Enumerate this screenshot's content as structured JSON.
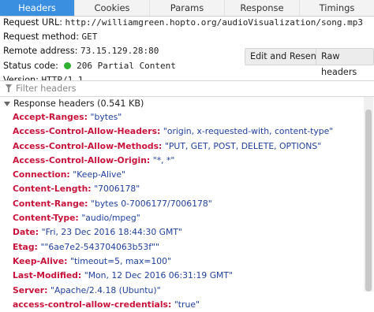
{
  "tabs": [
    {
      "label": "Headers",
      "active": true
    },
    {
      "label": "Cookies",
      "active": false
    },
    {
      "label": "Params",
      "active": false
    },
    {
      "label": "Response",
      "active": false
    },
    {
      "label": "Timings",
      "active": false
    }
  ],
  "summary": {
    "request_url_label": "Request URL:",
    "request_url": "http://williamgreen.hopto.org/audioVisualization/song.mp3",
    "request_method_label": "Request method:",
    "request_method": "GET",
    "remote_address_label": "Remote address:",
    "remote_address": "73.15.129.28:80",
    "status_code_label": "Status code:",
    "status_code": "206 Partial Content",
    "version_label": "Version:",
    "version": "HTTP/1.1"
  },
  "buttons": {
    "edit_resend": "Edit and Resend",
    "raw_headers": "Raw headers"
  },
  "filter": {
    "placeholder": "Filter headers"
  },
  "response_section": {
    "label": "Response headers (0.541 KB)"
  },
  "headers": [
    {
      "name": "Accept-Ranges:",
      "value": "\"bytes\""
    },
    {
      "name": "Access-Control-Allow-Headers:",
      "value": "\"origin, x-requested-with, content-type\""
    },
    {
      "name": "Access-Control-Allow-Methods:",
      "value": "\"PUT, GET, POST, DELETE, OPTIONS\""
    },
    {
      "name": "Access-Control-Allow-Origin:",
      "value": "\"*, *\""
    },
    {
      "name": "Connection:",
      "value": "\"Keep-Alive\""
    },
    {
      "name": "Content-Length:",
      "value": "\"7006178\""
    },
    {
      "name": "Content-Range:",
      "value": "\"bytes 0-7006177/7006178\""
    },
    {
      "name": "Content-Type:",
      "value": "\"audio/mpeg\""
    },
    {
      "name": "Date:",
      "value": "\"Fri, 23 Dec 2016 18:44:30 GMT\""
    },
    {
      "name": "Etag:",
      "value": "\"\"6ae7e2-543704063b53f\"\""
    },
    {
      "name": "Keep-Alive:",
      "value": "\"timeout=5, max=100\""
    },
    {
      "name": "Last-Modified:",
      "value": "\"Mon, 12 Dec 2016 06:31:19 GMT\""
    },
    {
      "name": "Server:",
      "value": "\"Apache/2.4.18 (Ubuntu)\""
    },
    {
      "name": "access-control-allow-credentials:",
      "value": "\"true\""
    }
  ],
  "colors": {
    "tab_active": "#3a8fe0",
    "header_name": "#c8143c",
    "header_value": "#1f3f9c",
    "status_ok": "#2fb030"
  }
}
